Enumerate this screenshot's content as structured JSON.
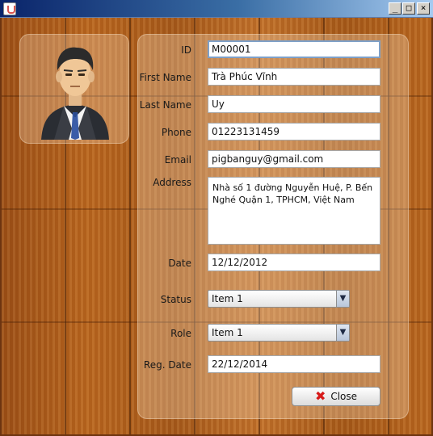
{
  "window": {
    "title": "",
    "minimize_glyph": "_",
    "maximize_glyph": "□",
    "close_glyph": "×"
  },
  "form": {
    "id_label": "ID",
    "id_value": "M00001",
    "first_name_label": "First Name",
    "first_name_value": "Trà Phúc Vĩnh",
    "last_name_label": "Last Name",
    "last_name_value": "Uy",
    "phone_label": "Phone",
    "phone_value": "01223131459",
    "email_label": "Email",
    "email_value": "pigbanguy@gmail.com",
    "address_label": "Address",
    "address_value": "Nhà số 1 đường Nguyễn Huệ, P. Bến Nghé Quận 1, TPHCM, Việt Nam",
    "date_label": "Date",
    "date_value": "12/12/2012",
    "status_label": "Status",
    "status_value": "Item 1",
    "role_label": "Role",
    "role_value": "Item 1",
    "reg_date_label": "Reg. Date",
    "reg_date_value": "22/12/2014",
    "close_label": "Close"
  },
  "icons": {
    "avatar": "businessman-avatar-icon",
    "close": "red-x-icon",
    "dropdown": "chevron-down-icon"
  },
  "colors": {
    "titlebar_start": "#0a246a",
    "wood": "#b8651e",
    "close_x": "#d71a1a"
  }
}
